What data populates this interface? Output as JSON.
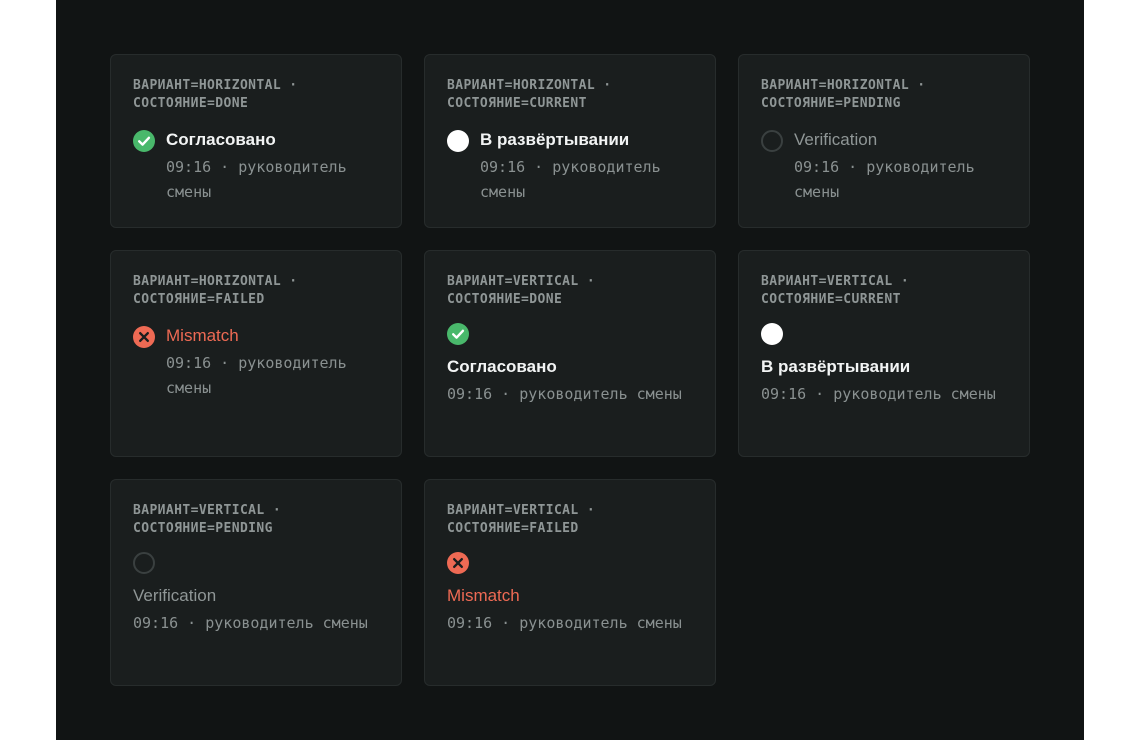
{
  "colors": {
    "background": "#111414",
    "card": "#1a1e1e",
    "done": "#49b86b",
    "current": "#ffffff",
    "pending_ring": "#3a4040",
    "failed": "#ee6a54"
  },
  "cards": [
    {
      "meta_line1": "ВАРИАНТ=HORIZONTAL ·",
      "meta_line2": "СОСТОЯНИЕ=DONE",
      "label": "Согласовано",
      "detail": "09:16 · руководитель смены",
      "icon": "check-circle-icon"
    },
    {
      "meta_line1": "ВАРИАНТ=HORIZONTAL ·",
      "meta_line2": "СОСТОЯНИЕ=CURRENT",
      "label": "В развёртывании",
      "detail": "09:16 · руководитель смены",
      "icon": "current-dot-icon"
    },
    {
      "meta_line1": "ВАРИАНТ=HORIZONTAL ·",
      "meta_line2": "СОСТОЯНИЕ=PENDING",
      "label": "Verification",
      "detail": "09:16 · руководитель смены",
      "icon": "pending-ring-icon"
    },
    {
      "meta_line1": "ВАРИАНТ=HORIZONTAL ·",
      "meta_line2": "СОСТОЯНИЕ=FAILED",
      "label": "Mismatch",
      "detail": "09:16 · руководитель смены",
      "icon": "x-circle-icon"
    },
    {
      "meta_line1": "ВАРИАНТ=VERTICAL ·",
      "meta_line2": "СОСТОЯНИЕ=DONE",
      "label": "Согласовано",
      "detail": "09:16 · руководитель смены",
      "icon": "check-circle-icon"
    },
    {
      "meta_line1": "ВАРИАНТ=VERTICAL ·",
      "meta_line2": "СОСТОЯНИЕ=CURRENT",
      "label": "В развёртывании",
      "detail": "09:16 · руководитель смены",
      "icon": "current-dot-icon"
    },
    {
      "meta_line1": "ВАРИАНТ=VERTICAL ·",
      "meta_line2": "СОСТОЯНИЕ=PENDING",
      "label": "Verification",
      "detail": "09:16 · руководитель смены",
      "icon": "pending-ring-icon"
    },
    {
      "meta_line1": "ВАРИАНТ=VERTICAL ·",
      "meta_line2": "СОСТОЯНИЕ=FAILED",
      "label": "Mismatch",
      "detail": "09:16 · руководитель смены",
      "icon": "x-circle-icon"
    }
  ]
}
